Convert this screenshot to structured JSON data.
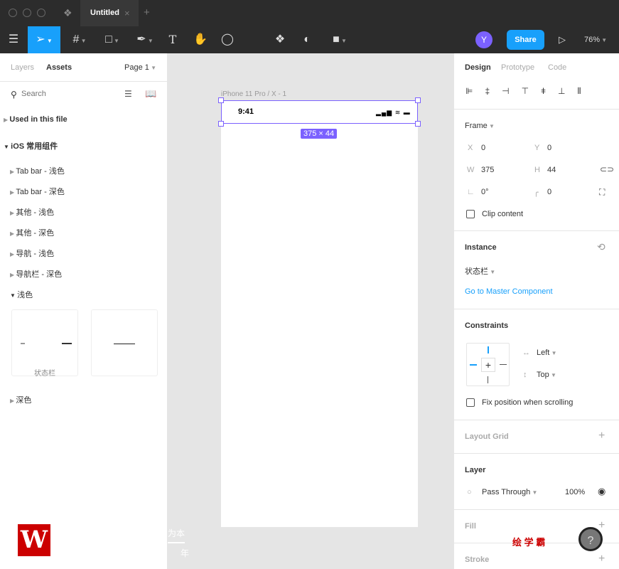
{
  "window": {
    "tab_title": "Untitled",
    "close": "×",
    "new_tab": "+"
  },
  "toolbar": {
    "avatar": "Y",
    "share": "Share",
    "zoom": "76%",
    "accent": "#18a0fb"
  },
  "left": {
    "tabs": [
      "Layers",
      "Assets"
    ],
    "page": "Page 1",
    "search_placeholder": "Search",
    "sections": {
      "used": "Used in this file",
      "library": "iOS 常用组件"
    },
    "items": [
      "Tab bar - 浅色",
      "Tab bar - 深色",
      "其他 - 浅色",
      "其他 - 深色",
      "导航 - 浅色",
      "导航栏 - 深色"
    ],
    "open_group": "浅色",
    "thumb_label": "状态栏",
    "closed_group": "深色"
  },
  "canvas": {
    "frame_name": "iPhone 11 Pro / X - 1",
    "time": "9:41",
    "size_badge": "375 × 44",
    "selection_color": "#7b61ff"
  },
  "right": {
    "tabs": [
      "Design",
      "Prototype",
      "Code"
    ],
    "frame": "Frame",
    "x_label": "X",
    "x": "0",
    "y_label": "Y",
    "y": "0",
    "w_label": "W",
    "w": "375",
    "h_label": "H",
    "h": "44",
    "rotation": "0°",
    "radius": "0",
    "clip": "Clip content",
    "instance": "Instance",
    "component": "状态栏",
    "master": "Go to Master Component",
    "constraints": "Constraints",
    "h_constraint": "Left",
    "v_constraint": "Top",
    "fix": "Fix position when scrolling",
    "layout_grid": "Layout Grid",
    "layer": "Layer",
    "blend": "Pass Through",
    "opacity": "100%",
    "fill": "Fill",
    "stroke": "Stroke"
  },
  "watermark": {
    "text": "绘 学 霸",
    "left_top": "为本",
    "left_bottom": "年",
    "help": "?"
  }
}
